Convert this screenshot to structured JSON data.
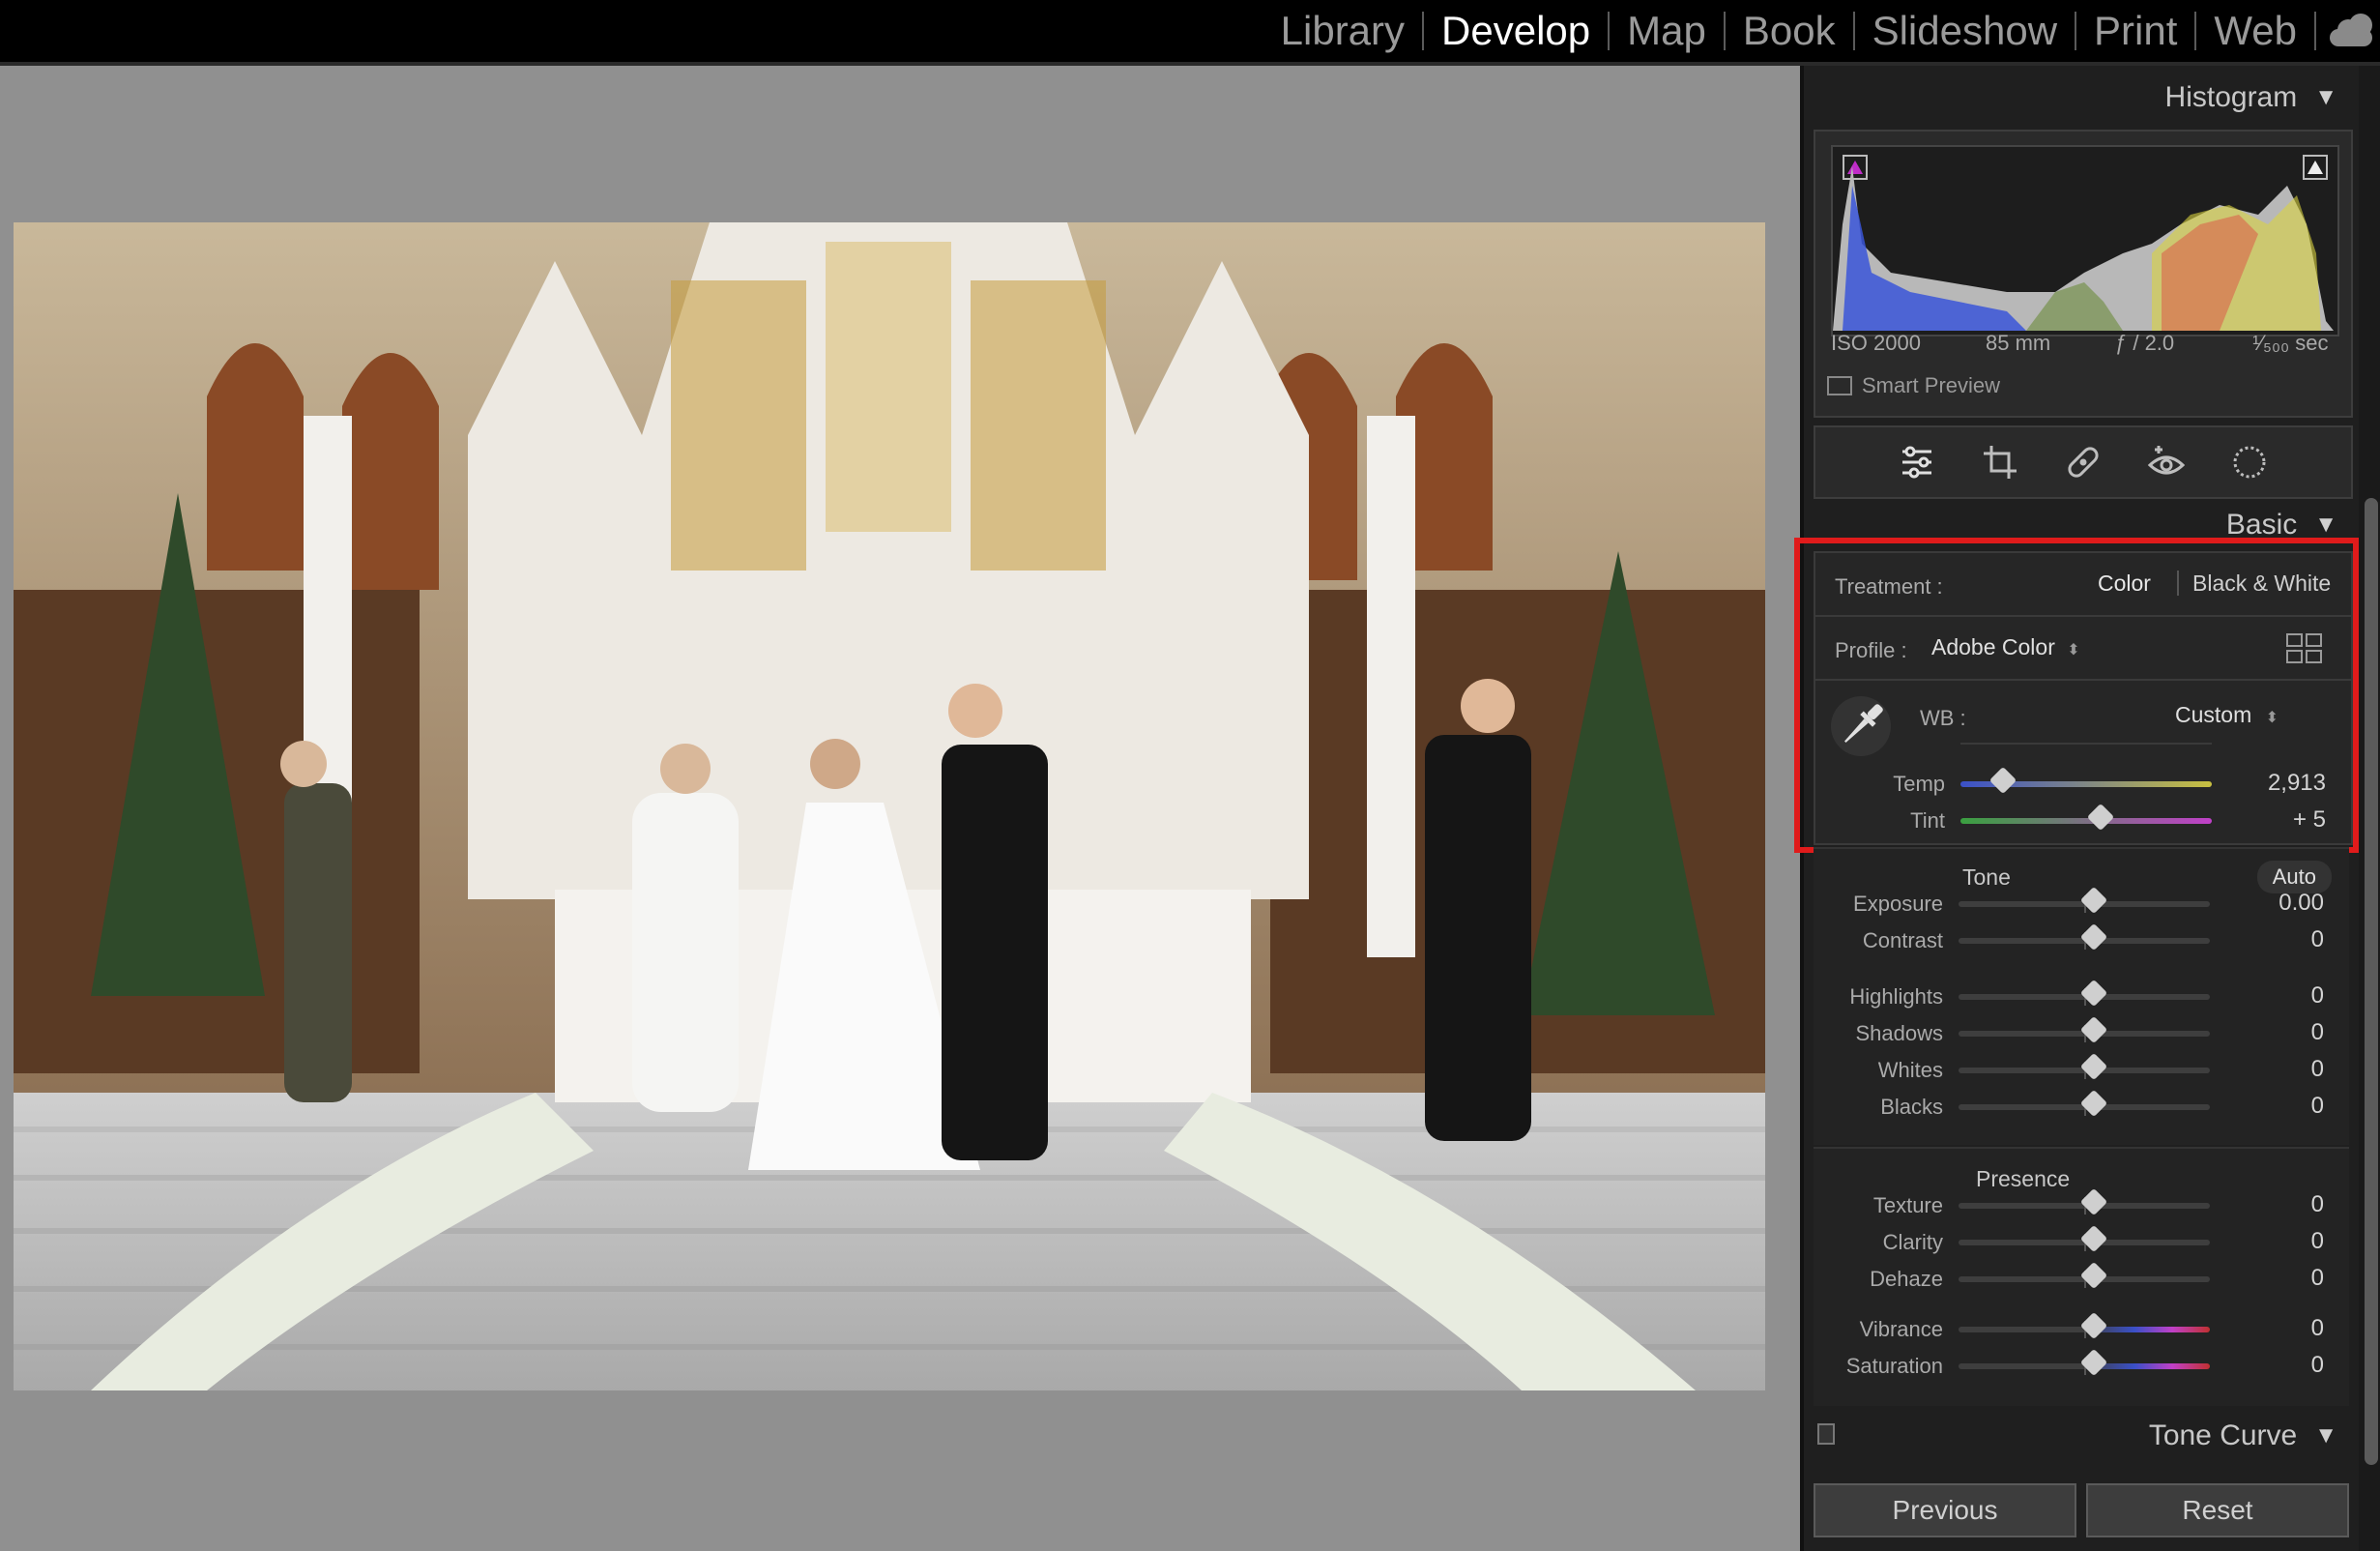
{
  "modules": [
    "Library",
    "Develop",
    "Map",
    "Book",
    "Slideshow",
    "Print",
    "Web"
  ],
  "active_module": "Develop",
  "histogram": {
    "title": "Histogram",
    "iso": "ISO 2000",
    "focal": "85 mm",
    "aperture": "ƒ / 2.0",
    "shutter": "¹⁄₅₀₀ sec",
    "smart_preview": "Smart Preview"
  },
  "tools": [
    "edit-sliders-icon",
    "crop-icon",
    "healing-icon",
    "redeye-icon",
    "masking-icon"
  ],
  "basic": {
    "title": "Basic",
    "treatment_label": "Treatment :",
    "treatment_color": "Color",
    "treatment_bw": "Black & White",
    "profile_label": "Profile :",
    "profile_value": "Adobe Color",
    "wb_label": "WB :",
    "wb_value": "Custom",
    "temp_label": "Temp",
    "temp_value": "2,913",
    "temp_pos": 0.13,
    "tint_label": "Tint",
    "tint_value": "+ 5",
    "tint_pos": 0.52,
    "tone_label": "Tone",
    "auto_label": "Auto",
    "tone_sliders": [
      {
        "label": "Exposure",
        "value": "0.00"
      },
      {
        "label": "Contrast",
        "value": "0"
      },
      {
        "label": "Highlights",
        "value": "0"
      },
      {
        "label": "Shadows",
        "value": "0"
      },
      {
        "label": "Whites",
        "value": "0"
      },
      {
        "label": "Blacks",
        "value": "0"
      }
    ],
    "presence_label": "Presence",
    "presence_sliders": [
      {
        "label": "Texture",
        "value": "0"
      },
      {
        "label": "Clarity",
        "value": "0"
      },
      {
        "label": "Dehaze",
        "value": "0"
      },
      {
        "label": "Vibrance",
        "value": "0"
      },
      {
        "label": "Saturation",
        "value": "0"
      }
    ]
  },
  "tone_curve": {
    "title": "Tone Curve"
  },
  "buttons": {
    "previous": "Previous",
    "reset": "Reset"
  },
  "colors": {
    "highlight": "#e01b1b",
    "panel": "#1f1f1f",
    "canvas": "#909090"
  }
}
